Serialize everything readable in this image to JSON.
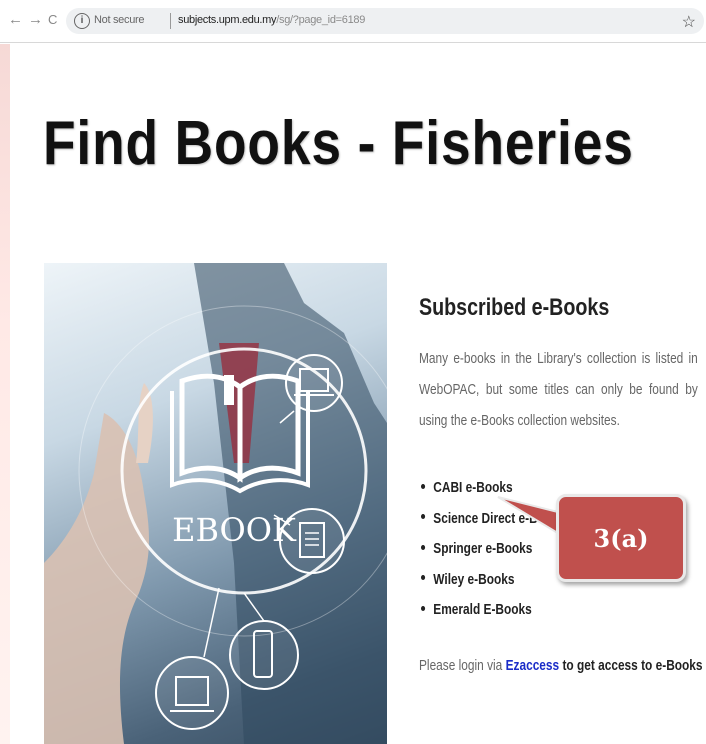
{
  "browser": {
    "back_glyph": "←",
    "forward_glyph": "→",
    "reload_glyph": "C",
    "info_glyph": "i",
    "security_label": "Not secure",
    "url_host": "subjects.upm.edu.my",
    "url_path": "/sg/?page_id=6189",
    "star_glyph": "☆"
  },
  "page": {
    "title": "Find Books - Fisheries",
    "hero_label": "EBOOK",
    "section_title": "Subscribed e-Books",
    "description": "Many e-books in the Library's collection is listed in WebOPAC, but some titles can only be found by using the e-Books collection websites.",
    "books": [
      {
        "label": "CABI e-Books"
      },
      {
        "label": "Science Direct e-Books"
      },
      {
        "label": "Springer e-Books"
      },
      {
        "label": "Wiley e-Books"
      },
      {
        "label": "Emerald E-Books"
      }
    ],
    "login_prefix": "Please login via ",
    "login_link": "Ezaccess",
    "login_suffix": " to get access to e-Books"
  },
  "annotation": {
    "callout_text": "3(a)",
    "callout_color": "#c0504d"
  }
}
